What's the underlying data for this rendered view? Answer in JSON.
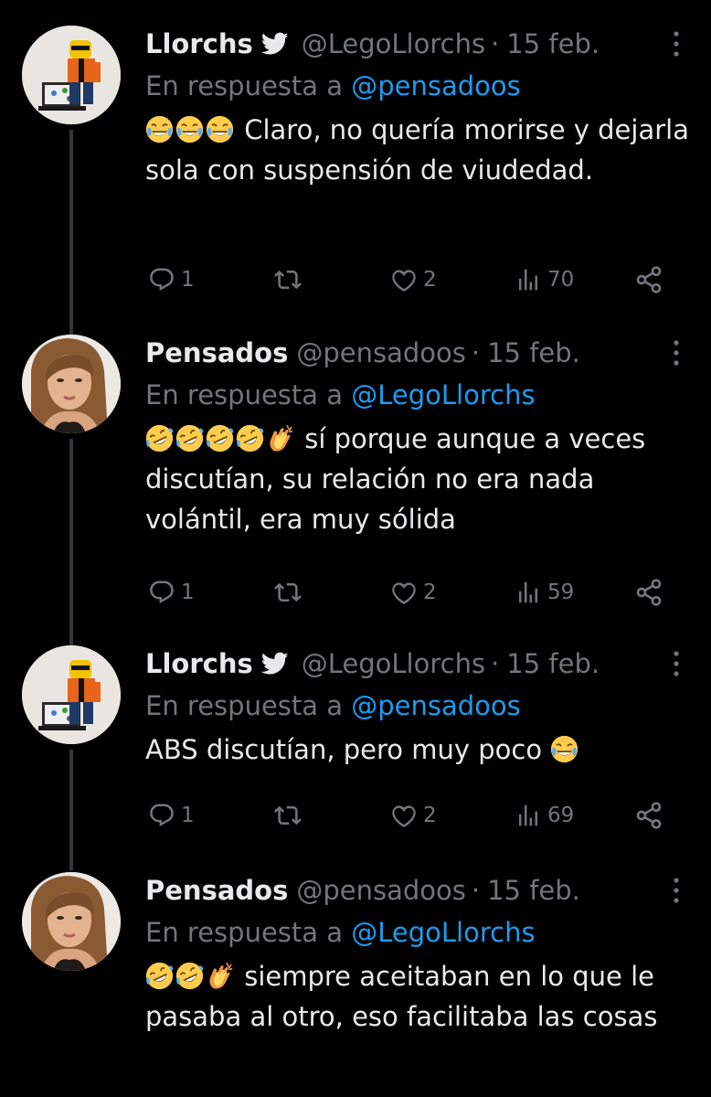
{
  "colors": {
    "background": "#000000",
    "text": "#e7e9ea",
    "secondary": "#71767b",
    "link": "#1d9bf0",
    "thread_line": "#333639"
  },
  "icons": {
    "verified": "twitter-bird-icon",
    "more": "more-vertical-icon",
    "reply": "reply-icon",
    "retweet": "retweet-icon",
    "like": "heart-icon",
    "views": "views-bar-icon",
    "share": "share-icon",
    "laugh": "face-with-tears-of-joy-emoji",
    "rofl": "rolling-on-the-floor-laughing-emoji",
    "clap": "clapping-hands-emoji"
  },
  "tweets": [
    {
      "name": "Llorchs",
      "handle": "@LegoLlorchs",
      "separator": "·",
      "time": "15 feb.",
      "reply_prefix": "En respuesta a",
      "reply_to": "@pensadoos",
      "text": "Claro, no quería morirse y dejarla sola con suspensión de viudedad.",
      "emoji_lead": [
        "face-with-tears-of-joy",
        "face-with-tears-of-joy",
        "face-with-tears-of-joy"
      ],
      "replies": "1",
      "retweets": "",
      "likes": "2",
      "views": "70"
    },
    {
      "name": "Pensados",
      "handle": "@pensadoos",
      "separator": "·",
      "time": "15 feb.",
      "reply_prefix": "En respuesta a",
      "reply_to": "@LegoLlorchs",
      "text": "sí porque aunque a veces discutían, su relación no era nada volántil, era muy sólida",
      "emoji_lead": [
        "rolling-on-the-floor-laughing",
        "rolling-on-the-floor-laughing",
        "rolling-on-the-floor-laughing",
        "rolling-on-the-floor-laughing",
        "clapping-hands"
      ],
      "replies": "1",
      "retweets": "",
      "likes": "2",
      "views": "59"
    },
    {
      "name": "Llorchs",
      "handle": "@LegoLlorchs",
      "separator": "·",
      "time": "15 feb.",
      "reply_prefix": "En respuesta a",
      "reply_to": "@pensadoos",
      "text": "ABS discutían, pero muy poco",
      "emoji_trail": [
        "face-with-tears-of-joy"
      ],
      "replies": "1",
      "retweets": "",
      "likes": "2",
      "views": "69"
    },
    {
      "name": "Pensados",
      "handle": "@pensadoos",
      "separator": "·",
      "time": "15 feb.",
      "reply_prefix": "En respuesta a",
      "reply_to": "@LegoLlorchs",
      "text": "siempre aceitaban en lo que le pasaba al otro, eso facilitaba las cosas",
      "emoji_lead": [
        "rolling-on-the-floor-laughing",
        "rolling-on-the-floor-laughing",
        "clapping-hands"
      ]
    }
  ]
}
